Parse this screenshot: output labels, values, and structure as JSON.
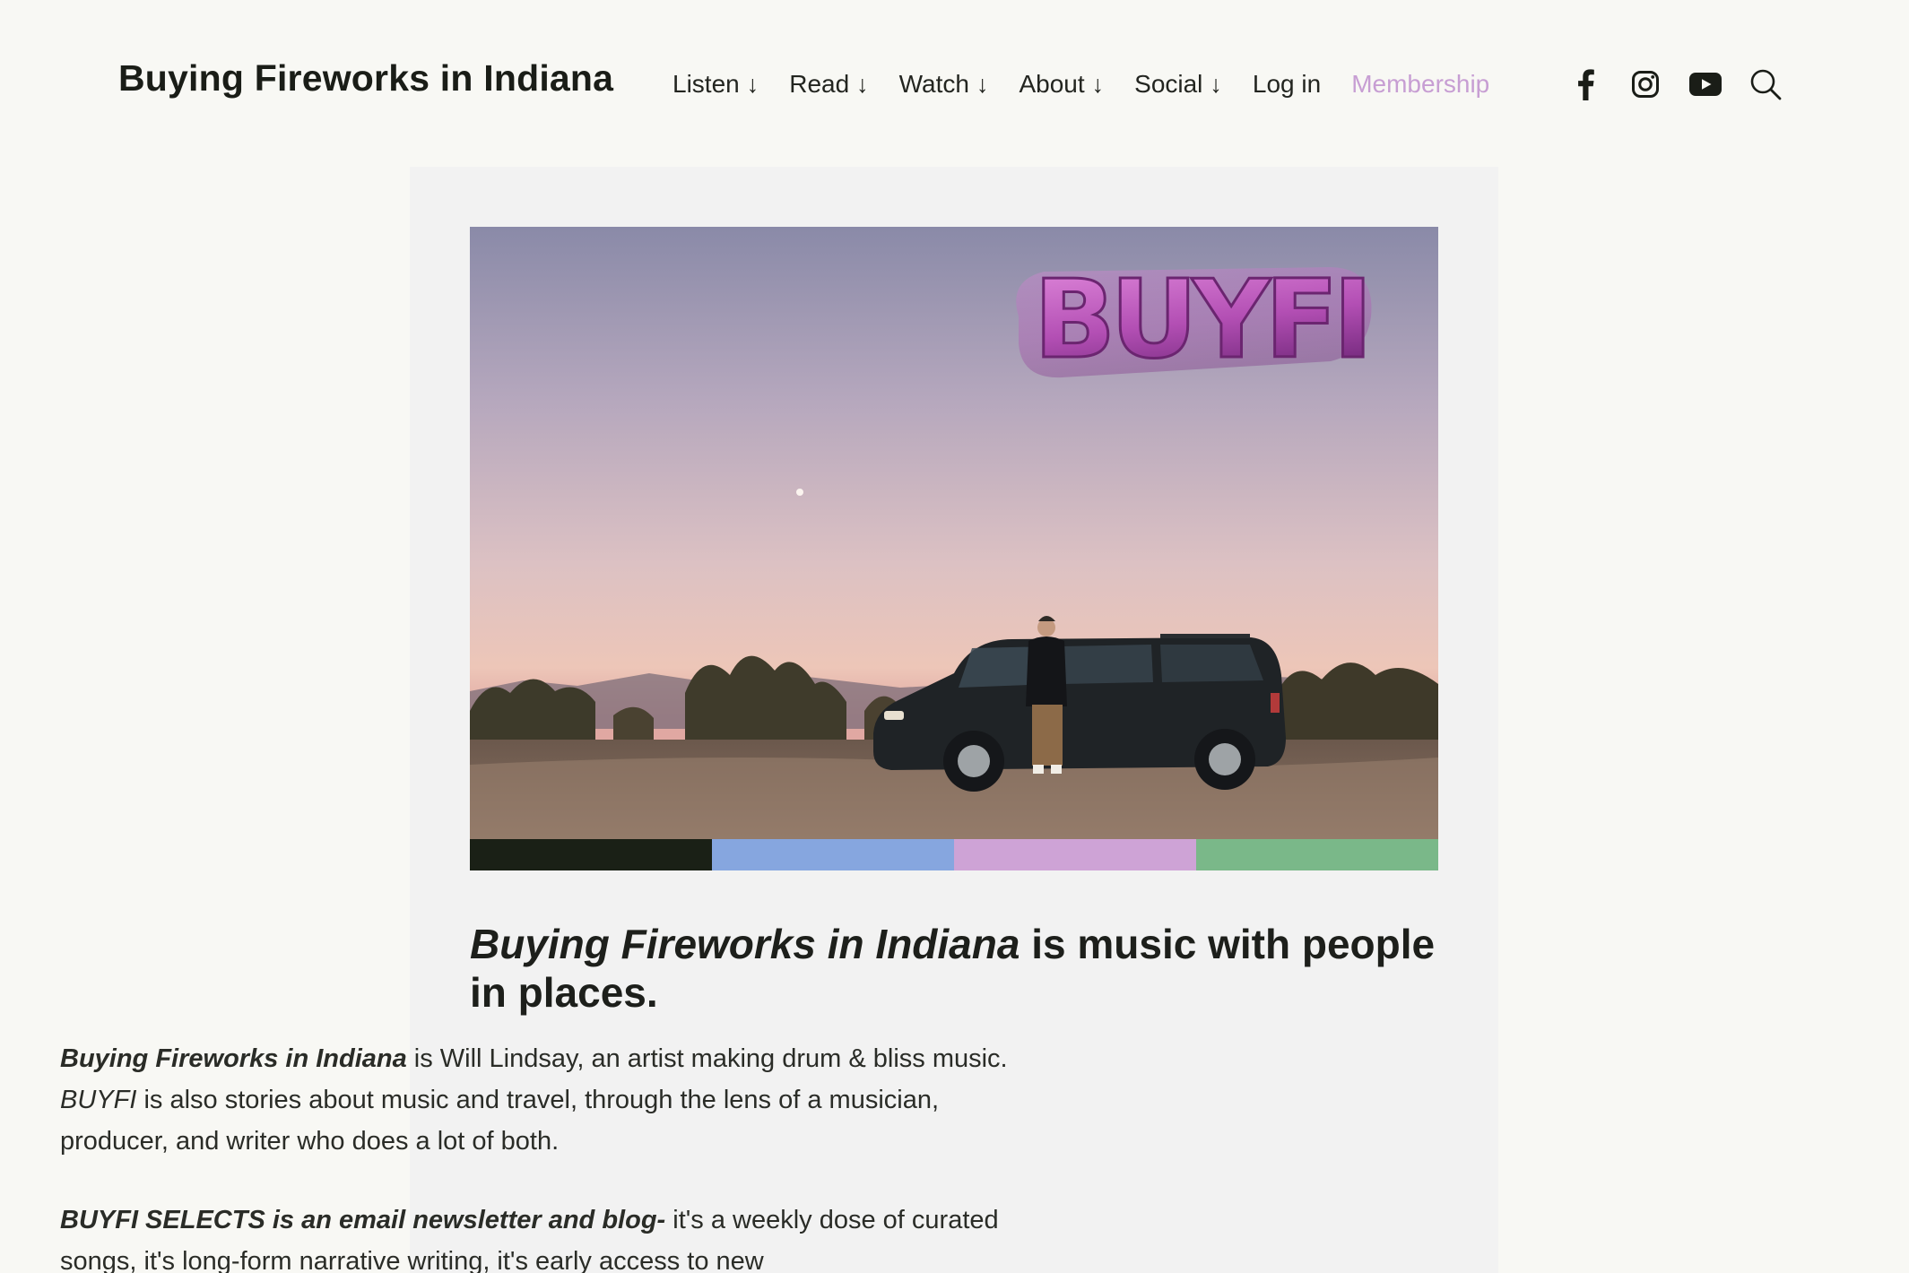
{
  "site": {
    "title": "Buying Fireworks in Indiana"
  },
  "nav": {
    "items": [
      {
        "label": "Listen",
        "arrow": "↓"
      },
      {
        "label": "Read",
        "arrow": "↓"
      },
      {
        "label": "Watch",
        "arrow": "↓"
      },
      {
        "label": "About",
        "arrow": "↓"
      },
      {
        "label": "Social",
        "arrow": "↓"
      }
    ],
    "login_label": "Log in",
    "membership_label": "Membership"
  },
  "social_icons": [
    "facebook-icon",
    "instagram-icon",
    "youtube-icon",
    "search-icon"
  ],
  "hero": {
    "logo_text": "BUYFI"
  },
  "swatch_colors": [
    "#1a2016",
    "#86a6df",
    "#cea3d6",
    "#7ab889"
  ],
  "content": {
    "headline_italic": "Buying Fireworks in Indiana",
    "headline_rest": " is music with people in places.",
    "p1_bold_italic": "Buying Fireworks in Indiana",
    "p1_a": " is Will Lindsay, an artist making drum & bliss music. ",
    "p1_italic": "BUYFI",
    "p1_b": " is also stories about music and travel, through the lens of a musician, producer, and writer who does a lot of both.",
    "p2_bold_italic": "BUYFI SELECTS is an email newsletter and blog-",
    "p2_rest": " it's a weekly dose of curated songs, it's long-form narrative writing, it's early access to new"
  },
  "colors": {
    "accent": "#c79ed3",
    "text": "#1d1f1b",
    "background": "#f8f8f4",
    "card": "#f2f2f2"
  }
}
